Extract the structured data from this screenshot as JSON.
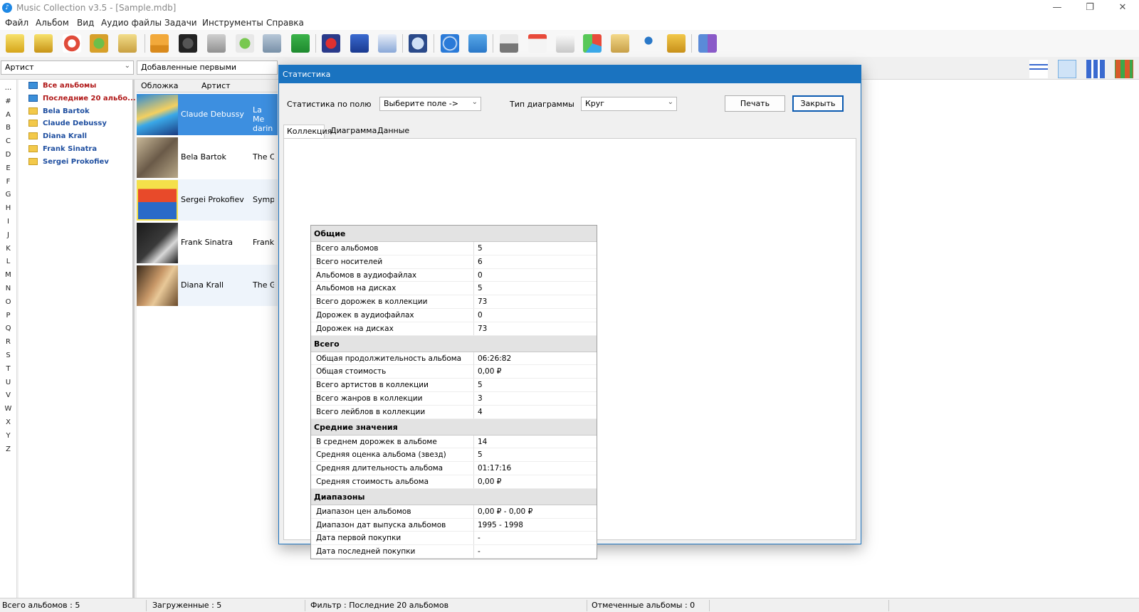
{
  "window": {
    "title": "Music Collection v3.5 - [Sample.mdb]",
    "min": "—",
    "restore": "❐",
    "close": "✕"
  },
  "menu": [
    "Файл",
    "Альбом",
    "Вид",
    "Аудио файлы",
    "Задачи",
    "Инструменты",
    "Справка"
  ],
  "toolbar_icons": [
    "add-album-icon",
    "add-collection-icon",
    "lifebuoy-icon",
    "web-import-icon",
    "search-db-icon",
    "eject-icon",
    "cd-text-icon",
    "download-icon",
    "find-icon",
    "network-icon",
    "add-file-icon",
    "remove-icon",
    "edit-icon",
    "properties-icon",
    "audio-search-icon",
    "play-icon",
    "shuffle-icon",
    "print-icon",
    "calendar-icon",
    "report-icon",
    "pie-chart-icon",
    "folder-icon",
    "user-icon",
    "export-icon",
    "exit-icon"
  ],
  "filters": {
    "field": "Артист",
    "sort": "Добавленные первыми"
  },
  "letters": [
    "...",
    "#",
    "A",
    "B",
    "C",
    "D",
    "E",
    "F",
    "G",
    "H",
    "I",
    "J",
    "K",
    "L",
    "M",
    "N",
    "O",
    "P",
    "Q",
    "R",
    "S",
    "T",
    "U",
    "V",
    "W",
    "X",
    "Y",
    "Z"
  ],
  "tree": [
    {
      "label": "Все альбомы",
      "style": "red-blue"
    },
    {
      "label": "Последние 20 альбо...",
      "style": "red-blue"
    },
    {
      "label": "Bela Bartok",
      "style": "folder"
    },
    {
      "label": "Claude Debussy",
      "style": "folder"
    },
    {
      "label": "Diana Krall",
      "style": "folder"
    },
    {
      "label": "Frank Sinatra",
      "style": "folder"
    },
    {
      "label": "Sergei Prokofiev",
      "style": "folder"
    }
  ],
  "albums": {
    "col_cover": "Обложка",
    "col_artist": "Артист",
    "rows": [
      {
        "artist": "Claude Debussy",
        "album": "La Me darin",
        "selected": true
      },
      {
        "artist": "Bela Bartok",
        "album": "The C",
        "selected": false
      },
      {
        "artist": "Sergei Prokofiev",
        "album": "Symph",
        "selected": false
      },
      {
        "artist": "Frank Sinatra",
        "album": "Frank",
        "selected": false
      },
      {
        "artist": "Diana Krall",
        "album": "The G",
        "selected": false
      }
    ]
  },
  "dialog": {
    "title": "Статистика",
    "field_label": "Статистика по полю",
    "field_value": "Выберите поле ->",
    "chart_type_label": "Тип диаграммы",
    "chart_type_value": "Круг",
    "print_button": "Печать",
    "close_button": "Закрыть",
    "tabs": [
      "Коллекция",
      "Диаграмма",
      "Данные"
    ],
    "sections": [
      {
        "title": "Общие",
        "rows": [
          [
            "Всего альбомов",
            "5"
          ],
          [
            "Всего носителей",
            "6"
          ],
          [
            "Альбомов в аудиофайлах",
            "0"
          ],
          [
            "Альбомов на дисках",
            "5"
          ],
          [
            "Всего дорожек в коллекции",
            "73"
          ],
          [
            "Дорожек в аудиофайлах",
            "0"
          ],
          [
            "Дорожек на дисках",
            "73"
          ]
        ]
      },
      {
        "title": "Всего",
        "rows": [
          [
            "Общая продолжительность альбома",
            "06:26:82"
          ],
          [
            "Общая стоимость",
            "0,00 ₽"
          ],
          [
            "Всего артистов в коллекции",
            "5"
          ],
          [
            "Всего жанров в коллекции",
            "3"
          ],
          [
            "Всего лейблов в коллекции",
            "4"
          ]
        ]
      },
      {
        "title": "Средние значения",
        "rows": [
          [
            "В среднем дорожек в альбоме",
            "14"
          ],
          [
            "Средняя оценка альбома (звезд)",
            "5"
          ],
          [
            "Средняя длительность альбома",
            "01:17:16"
          ],
          [
            "Средняя стоимость альбома",
            "0,00 ₽"
          ]
        ]
      },
      {
        "title": "Диапазоны",
        "rows": [
          [
            "Диапазон цен альбомов",
            "0,00 ₽  -  0,00 ₽"
          ],
          [
            "Диапазон дат выпуска альбомов",
            "1995  -  1998"
          ],
          [
            "Дата первой покупки",
            " -"
          ],
          [
            "Дата последней покупки",
            " -"
          ]
        ]
      }
    ]
  },
  "status": {
    "total": "Всего альбомов : 5",
    "loaded": "Загруженные : 5",
    "filter": "Фильтр : Последние 20 альбомов",
    "marked": "Отмеченные альбомы : 0"
  },
  "colors": {
    "accent": "#1a73c0",
    "selected_row": "#3d8fe0",
    "tree_red": "#b01818",
    "tree_blue": "#1f4fa0"
  }
}
